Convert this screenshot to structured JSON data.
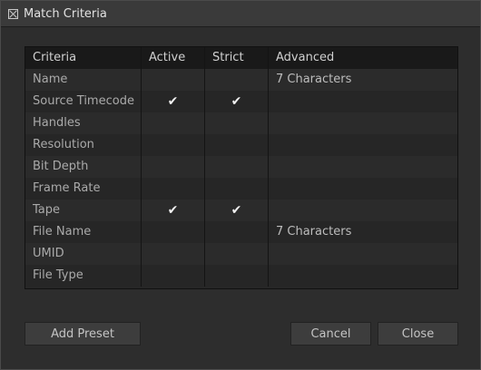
{
  "window": {
    "title": "Match Criteria"
  },
  "table": {
    "columns": [
      "Criteria",
      "Active",
      "Strict",
      "Advanced"
    ],
    "rows": [
      {
        "criteria": "Name",
        "active": "",
        "strict": "",
        "advanced": "7 Characters"
      },
      {
        "criteria": "Source Timecode",
        "active": "✔",
        "strict": "✔",
        "advanced": ""
      },
      {
        "criteria": "Handles",
        "active": "",
        "strict": "",
        "advanced": ""
      },
      {
        "criteria": "Resolution",
        "active": "",
        "strict": "",
        "advanced": ""
      },
      {
        "criteria": "Bit Depth",
        "active": "",
        "strict": "",
        "advanced": ""
      },
      {
        "criteria": "Frame Rate",
        "active": "",
        "strict": "",
        "advanced": ""
      },
      {
        "criteria": "Tape",
        "active": "✔",
        "strict": "✔",
        "advanced": ""
      },
      {
        "criteria": "File Name",
        "active": "",
        "strict": "",
        "advanced": "7 Characters"
      },
      {
        "criteria": "UMID",
        "active": "",
        "strict": "",
        "advanced": ""
      },
      {
        "criteria": "File Type",
        "active": "",
        "strict": "",
        "advanced": ""
      }
    ]
  },
  "buttons": {
    "add_preset": "Add Preset",
    "cancel": "Cancel",
    "close": "Close"
  }
}
